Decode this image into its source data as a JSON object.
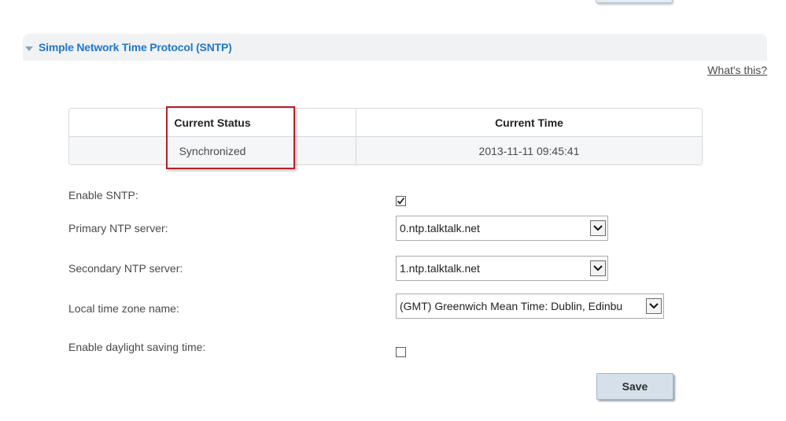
{
  "section": {
    "title": "Simple Network Time Protocol (SNTP)",
    "help_link": "What's this?"
  },
  "status_table": {
    "headers": [
      "Current Status",
      "Current Time"
    ],
    "values": [
      "Synchronized",
      "2013-11-11 09:45:41"
    ]
  },
  "form": {
    "enable_sntp": {
      "label": "Enable SNTP:",
      "checked": true
    },
    "primary_ntp": {
      "label": "Primary NTP server:",
      "value": "0.ntp.talktalk.net"
    },
    "secondary_ntp": {
      "label": "Secondary NTP server:",
      "value": "1.ntp.talktalk.net"
    },
    "timezone": {
      "label": "Local time zone name:",
      "value": "(GMT) Greenwich Mean Time: Dublin, Edinbu"
    },
    "daylight_saving": {
      "label": "Enable daylight saving time:",
      "checked": false
    }
  },
  "buttons": {
    "save": "Save"
  },
  "colors": {
    "header_title": "#1f78c8",
    "highlight_border": "#b0232a",
    "save_button_bg": "#d5e0ea"
  }
}
